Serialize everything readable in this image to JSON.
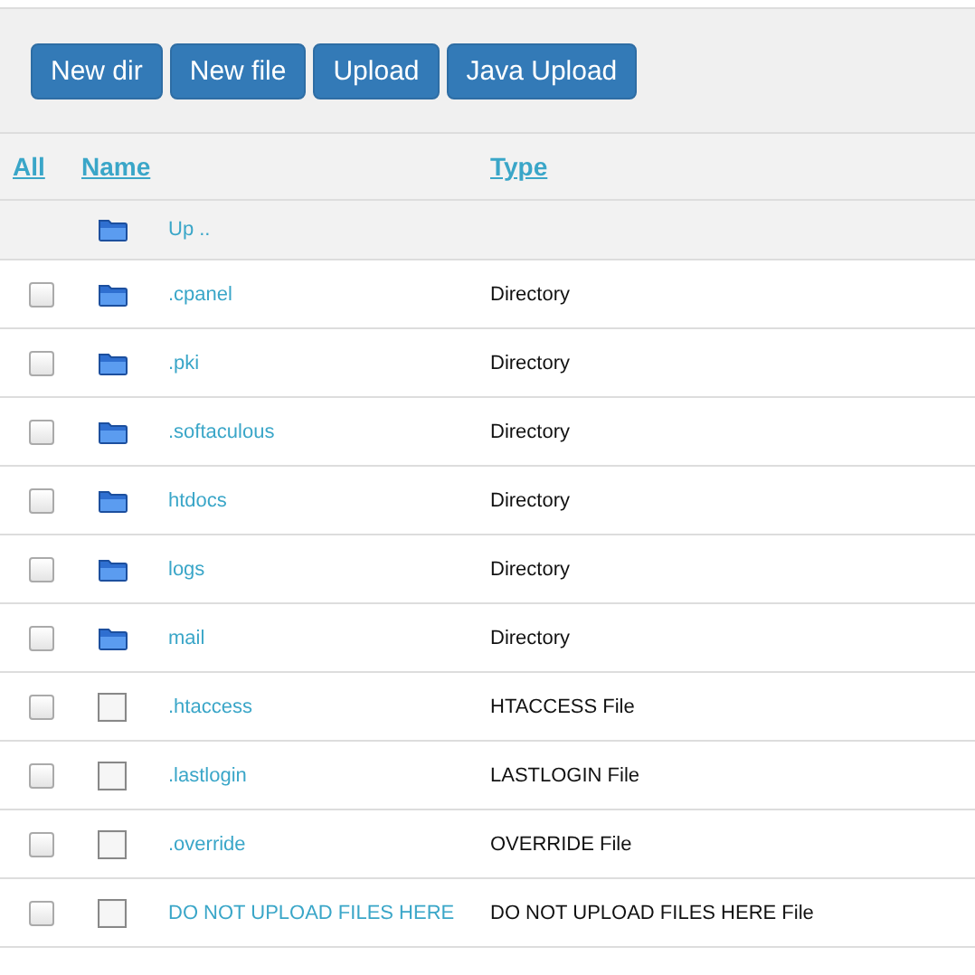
{
  "toolbar": {
    "buttons": [
      "New dir",
      "New file",
      "Upload",
      "Java Upload"
    ]
  },
  "table": {
    "columns": [
      "All",
      "Name",
      "Type"
    ],
    "up_row": {
      "kind": "folder",
      "name": "Up .."
    },
    "rows": [
      {
        "kind": "folder",
        "name": ".cpanel",
        "type": "Directory",
        "checked": false
      },
      {
        "kind": "folder",
        "name": ".pki",
        "type": "Directory",
        "checked": false
      },
      {
        "kind": "folder",
        "name": ".softaculous",
        "type": "Directory",
        "checked": false
      },
      {
        "kind": "folder",
        "name": "htdocs",
        "type": "Directory",
        "checked": false
      },
      {
        "kind": "folder",
        "name": "logs",
        "type": "Directory",
        "checked": false
      },
      {
        "kind": "folder",
        "name": "mail",
        "type": "Directory",
        "checked": false
      },
      {
        "kind": "file",
        "name": ".htaccess",
        "type": "HTACCESS File",
        "checked": false
      },
      {
        "kind": "file",
        "name": ".lastlogin",
        "type": "LASTLOGIN File",
        "checked": false
      },
      {
        "kind": "file",
        "name": ".override",
        "type": "OVERRIDE File",
        "checked": false
      },
      {
        "kind": "file",
        "name": "DO NOT UPLOAD FILES HERE",
        "type": "DO NOT UPLOAD FILES HERE File",
        "checked": false
      }
    ]
  }
}
